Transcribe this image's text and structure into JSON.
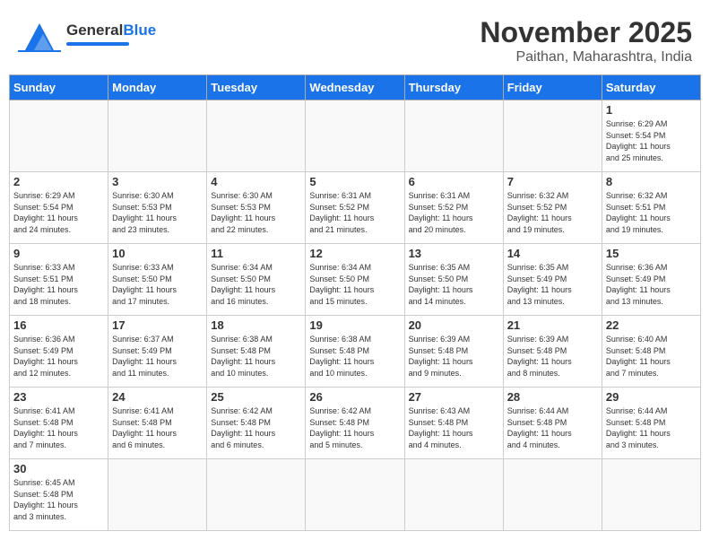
{
  "header": {
    "logo_general": "General",
    "logo_blue": "Blue",
    "title": "November 2025",
    "subtitle": "Paithan, Maharashtra, India"
  },
  "days_of_week": [
    "Sunday",
    "Monday",
    "Tuesday",
    "Wednesday",
    "Thursday",
    "Friday",
    "Saturday"
  ],
  "weeks": [
    [
      {
        "day": "",
        "info": ""
      },
      {
        "day": "",
        "info": ""
      },
      {
        "day": "",
        "info": ""
      },
      {
        "day": "",
        "info": ""
      },
      {
        "day": "",
        "info": ""
      },
      {
        "day": "",
        "info": ""
      },
      {
        "day": "1",
        "info": "Sunrise: 6:29 AM\nSunset: 5:54 PM\nDaylight: 11 hours\nand 25 minutes."
      }
    ],
    [
      {
        "day": "2",
        "info": "Sunrise: 6:29 AM\nSunset: 5:54 PM\nDaylight: 11 hours\nand 24 minutes."
      },
      {
        "day": "3",
        "info": "Sunrise: 6:30 AM\nSunset: 5:53 PM\nDaylight: 11 hours\nand 23 minutes."
      },
      {
        "day": "4",
        "info": "Sunrise: 6:30 AM\nSunset: 5:53 PM\nDaylight: 11 hours\nand 22 minutes."
      },
      {
        "day": "5",
        "info": "Sunrise: 6:31 AM\nSunset: 5:52 PM\nDaylight: 11 hours\nand 21 minutes."
      },
      {
        "day": "6",
        "info": "Sunrise: 6:31 AM\nSunset: 5:52 PM\nDaylight: 11 hours\nand 20 minutes."
      },
      {
        "day": "7",
        "info": "Sunrise: 6:32 AM\nSunset: 5:52 PM\nDaylight: 11 hours\nand 19 minutes."
      },
      {
        "day": "8",
        "info": "Sunrise: 6:32 AM\nSunset: 5:51 PM\nDaylight: 11 hours\nand 19 minutes."
      }
    ],
    [
      {
        "day": "9",
        "info": "Sunrise: 6:33 AM\nSunset: 5:51 PM\nDaylight: 11 hours\nand 18 minutes."
      },
      {
        "day": "10",
        "info": "Sunrise: 6:33 AM\nSunset: 5:50 PM\nDaylight: 11 hours\nand 17 minutes."
      },
      {
        "day": "11",
        "info": "Sunrise: 6:34 AM\nSunset: 5:50 PM\nDaylight: 11 hours\nand 16 minutes."
      },
      {
        "day": "12",
        "info": "Sunrise: 6:34 AM\nSunset: 5:50 PM\nDaylight: 11 hours\nand 15 minutes."
      },
      {
        "day": "13",
        "info": "Sunrise: 6:35 AM\nSunset: 5:50 PM\nDaylight: 11 hours\nand 14 minutes."
      },
      {
        "day": "14",
        "info": "Sunrise: 6:35 AM\nSunset: 5:49 PM\nDaylight: 11 hours\nand 13 minutes."
      },
      {
        "day": "15",
        "info": "Sunrise: 6:36 AM\nSunset: 5:49 PM\nDaylight: 11 hours\nand 13 minutes."
      }
    ],
    [
      {
        "day": "16",
        "info": "Sunrise: 6:36 AM\nSunset: 5:49 PM\nDaylight: 11 hours\nand 12 minutes."
      },
      {
        "day": "17",
        "info": "Sunrise: 6:37 AM\nSunset: 5:49 PM\nDaylight: 11 hours\nand 11 minutes."
      },
      {
        "day": "18",
        "info": "Sunrise: 6:38 AM\nSunset: 5:48 PM\nDaylight: 11 hours\nand 10 minutes."
      },
      {
        "day": "19",
        "info": "Sunrise: 6:38 AM\nSunset: 5:48 PM\nDaylight: 11 hours\nand 10 minutes."
      },
      {
        "day": "20",
        "info": "Sunrise: 6:39 AM\nSunset: 5:48 PM\nDaylight: 11 hours\nand 9 minutes."
      },
      {
        "day": "21",
        "info": "Sunrise: 6:39 AM\nSunset: 5:48 PM\nDaylight: 11 hours\nand 8 minutes."
      },
      {
        "day": "22",
        "info": "Sunrise: 6:40 AM\nSunset: 5:48 PM\nDaylight: 11 hours\nand 7 minutes."
      }
    ],
    [
      {
        "day": "23",
        "info": "Sunrise: 6:41 AM\nSunset: 5:48 PM\nDaylight: 11 hours\nand 7 minutes."
      },
      {
        "day": "24",
        "info": "Sunrise: 6:41 AM\nSunset: 5:48 PM\nDaylight: 11 hours\nand 6 minutes."
      },
      {
        "day": "25",
        "info": "Sunrise: 6:42 AM\nSunset: 5:48 PM\nDaylight: 11 hours\nand 6 minutes."
      },
      {
        "day": "26",
        "info": "Sunrise: 6:42 AM\nSunset: 5:48 PM\nDaylight: 11 hours\nand 5 minutes."
      },
      {
        "day": "27",
        "info": "Sunrise: 6:43 AM\nSunset: 5:48 PM\nDaylight: 11 hours\nand 4 minutes."
      },
      {
        "day": "28",
        "info": "Sunrise: 6:44 AM\nSunset: 5:48 PM\nDaylight: 11 hours\nand 4 minutes."
      },
      {
        "day": "29",
        "info": "Sunrise: 6:44 AM\nSunset: 5:48 PM\nDaylight: 11 hours\nand 3 minutes."
      }
    ],
    [
      {
        "day": "30",
        "info": "Sunrise: 6:45 AM\nSunset: 5:48 PM\nDaylight: 11 hours\nand 3 minutes."
      },
      {
        "day": "",
        "info": ""
      },
      {
        "day": "",
        "info": ""
      },
      {
        "day": "",
        "info": ""
      },
      {
        "day": "",
        "info": ""
      },
      {
        "day": "",
        "info": ""
      },
      {
        "day": "",
        "info": ""
      }
    ]
  ]
}
